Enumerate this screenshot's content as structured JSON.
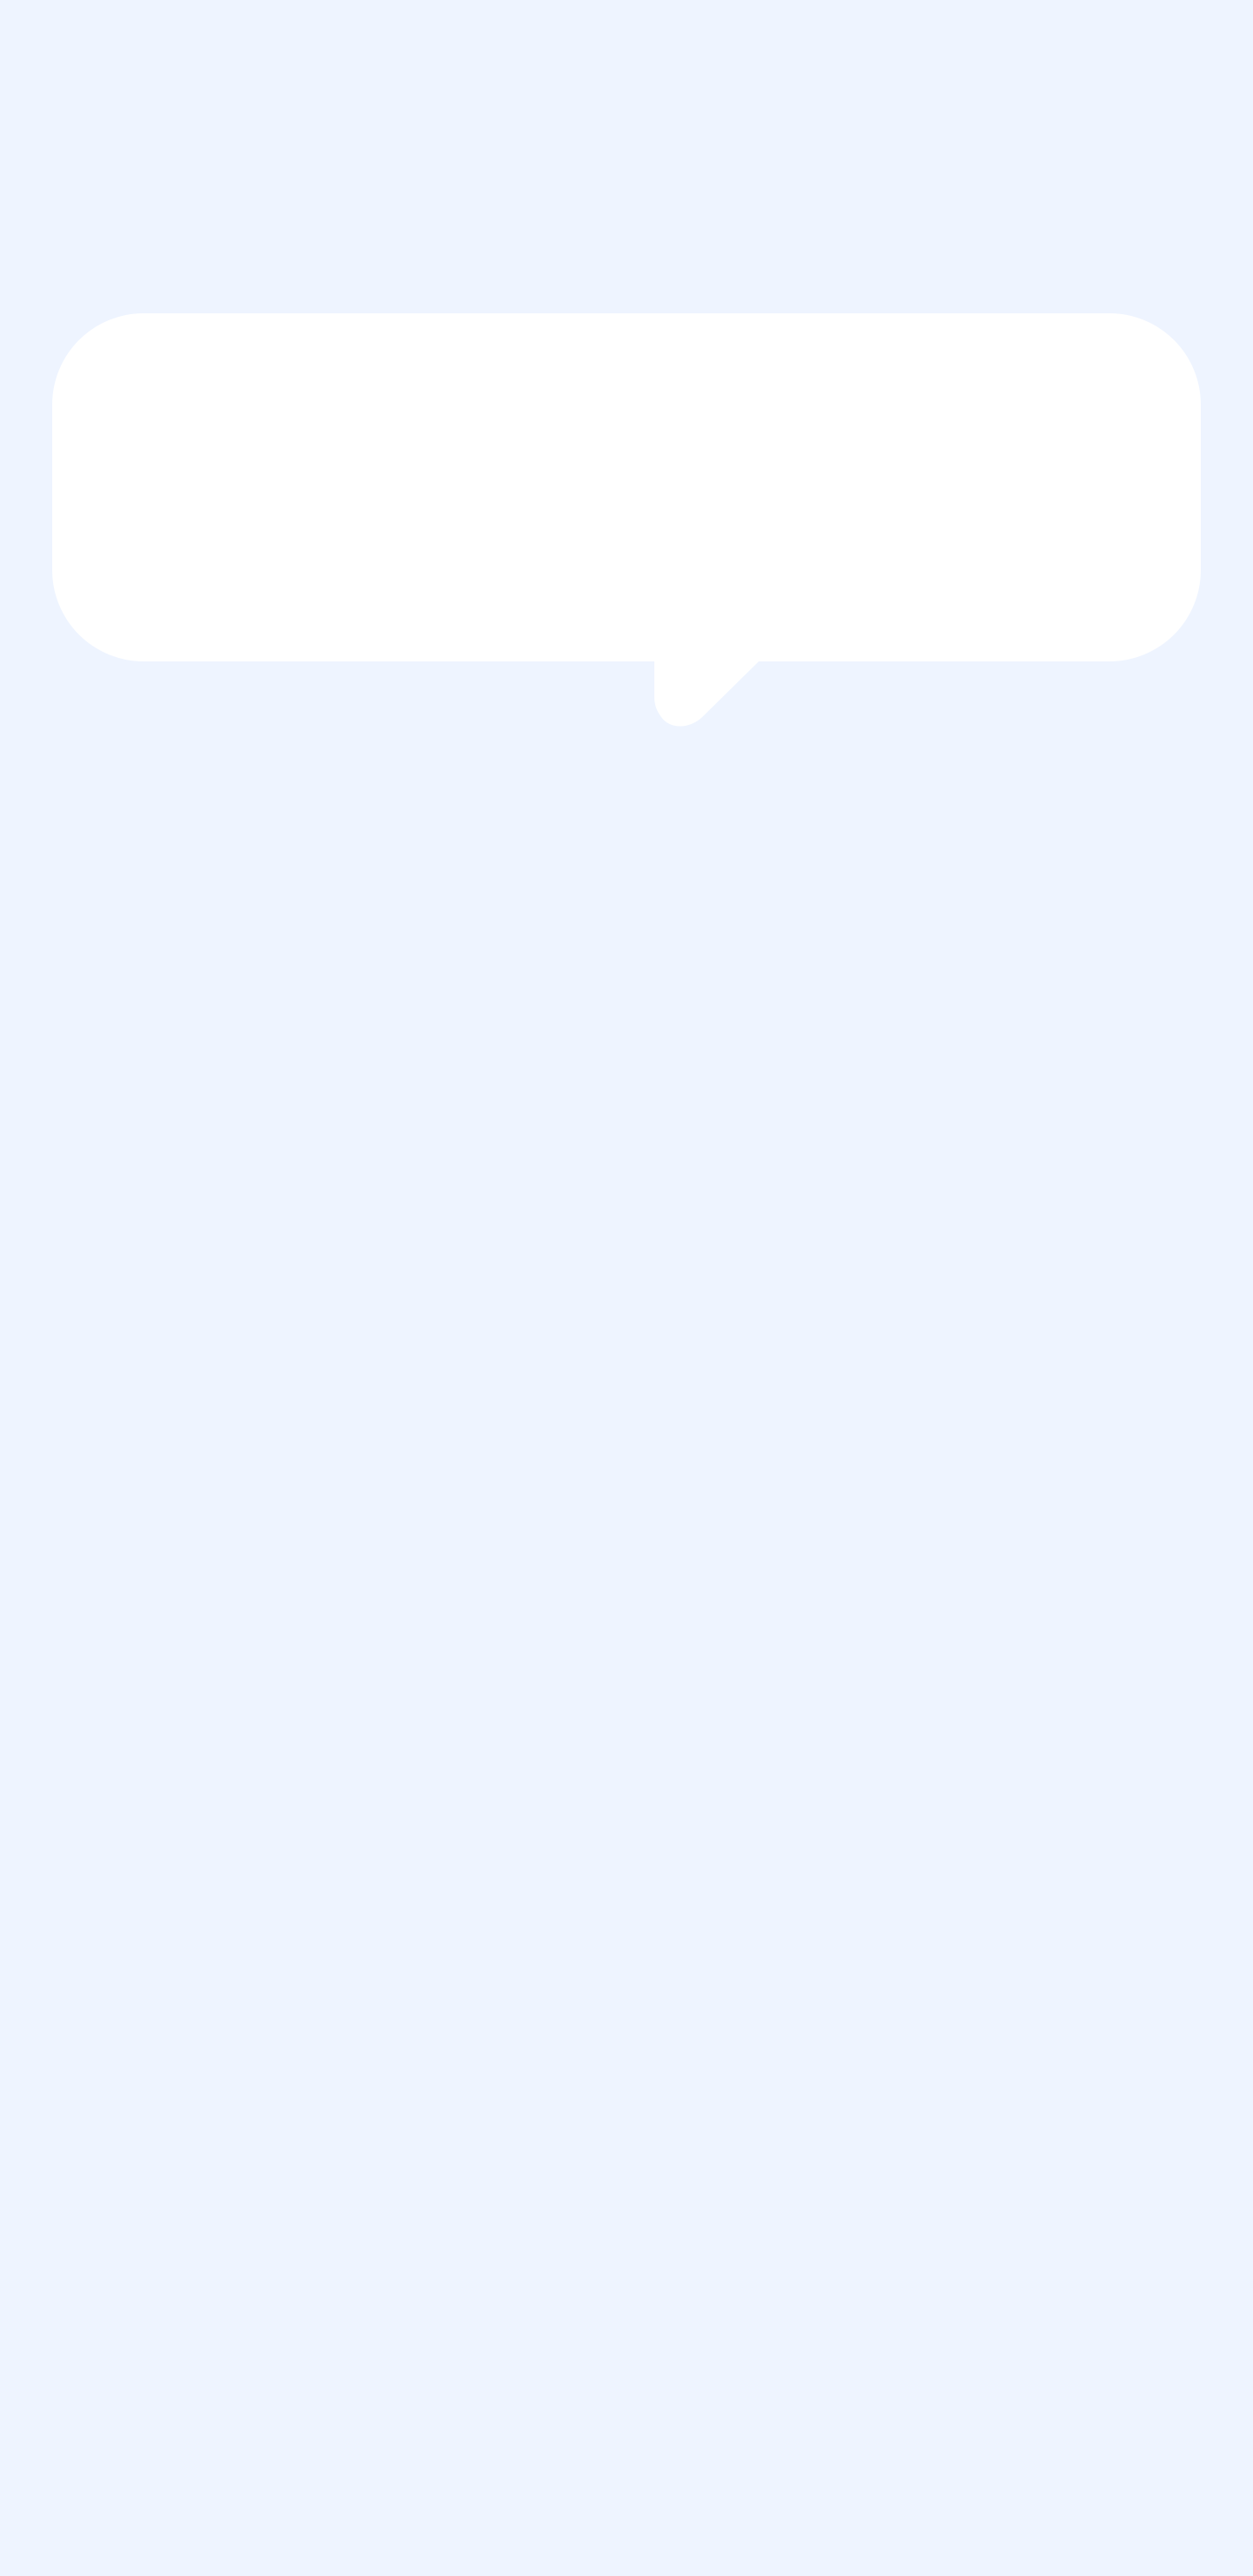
{
  "colors": {
    "background": "#eef4ff",
    "bubble": "#ffffff"
  },
  "bubble": {
    "text": ""
  }
}
